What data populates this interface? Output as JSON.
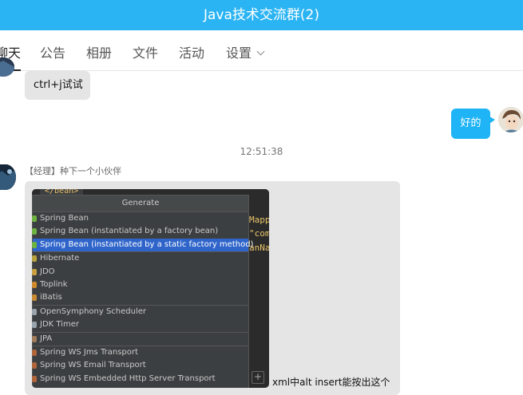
{
  "header": {
    "title": "Java技术交流群(2)"
  },
  "tabs": [
    {
      "label": "聊天",
      "active": true
    },
    {
      "label": "公告"
    },
    {
      "label": "相册"
    },
    {
      "label": "文件"
    },
    {
      "label": "活动"
    },
    {
      "label": "设置"
    }
  ],
  "messages": {
    "first": {
      "text": "ctrl+j试试"
    },
    "reply": {
      "text": "好的"
    },
    "timestamp": "12:51:38",
    "sender": "【经理】种下一个小伙伴",
    "caption": "xml中alt insert能按出这个"
  },
  "screenshot": {
    "tag": "</bean>",
    "code_lines": [
      "Mapp",
      "\"com",
      "anNa"
    ],
    "popup_title": "Generate",
    "items": [
      {
        "label": "Spring Bean",
        "icon": "spring-icon"
      },
      {
        "label": "Spring Bean (instantiated by a factory bean)",
        "icon": "spring-icon"
      },
      {
        "label": "Spring Bean (instantiated by a static factory method)",
        "icon": "spring-icon",
        "selected": true
      },
      {
        "label": "Hibernate",
        "icon": "hibernate-icon"
      },
      {
        "label": "JDO",
        "icon": "jdo-icon"
      },
      {
        "label": "Toplink",
        "icon": "toplink-icon"
      },
      {
        "label": "iBatis",
        "icon": "ibatis-icon"
      },
      {
        "label": "OpenSymphony Scheduler",
        "icon": "scheduler-icon"
      },
      {
        "label": "JDK Timer",
        "icon": "timer-icon"
      },
      {
        "label": "JPA",
        "icon": "jpa-icon"
      },
      {
        "label": "Spring WS Jms Transport",
        "icon": "ws-icon"
      },
      {
        "label": "Spring WS Email Transport",
        "icon": "ws-icon"
      },
      {
        "label": "Spring WS Embedded Http Server Transport",
        "icon": "ws-icon"
      }
    ],
    "plus": "+"
  },
  "colors": {
    "accent": "#2bb4f3",
    "bubble_blue": "#1fb4f5",
    "selection": "#2f65ca"
  }
}
